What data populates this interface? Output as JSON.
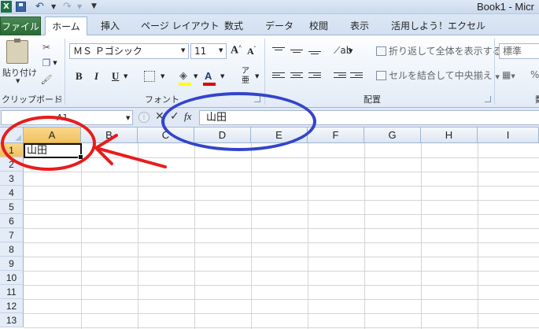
{
  "titlebar": {
    "app_icon_letter": "X",
    "window_title": "Book1 - Micr"
  },
  "ribbon_tabs": {
    "file": "ファイル",
    "items": [
      "ホーム",
      "挿入",
      "ページ レイアウト",
      "数式",
      "データ",
      "校閲",
      "表示",
      "活用しよう！エクセル"
    ],
    "active": "ホーム"
  },
  "clipboard": {
    "paste_label": "貼り付け",
    "group_label": "クリップボード"
  },
  "font": {
    "name": "ＭＳ Ｐゴシック",
    "size": "11",
    "grow": "A",
    "shrink": "A",
    "bold": "B",
    "italic": "I",
    "underline": "U",
    "font_color_glyph": "A",
    "phonetic_top": "ア",
    "phonetic_bottom": "亜",
    "group_label": "フォント"
  },
  "alignment": {
    "wrap_text": "折り返して全体を表示する",
    "merge_center": "セルを結合して中央揃え",
    "group_label": "配置"
  },
  "number": {
    "format": "標準",
    "currency_glyph": "",
    "percent_glyph": "%",
    "group_label_partial": "数"
  },
  "formula_bar": {
    "name_box": "A1",
    "cancel_glyph": "✕",
    "enter_glyph": "✓",
    "fx_label": "fx",
    "formula": "山田"
  },
  "grid": {
    "columns": [
      "A",
      "B",
      "C",
      "D",
      "E",
      "F",
      "G",
      "H",
      "I"
    ],
    "rows": [
      "1",
      "2",
      "3",
      "4",
      "5",
      "6",
      "7",
      "8",
      "9",
      "10",
      "11",
      "12",
      "13"
    ],
    "selected_column": "A",
    "selected_row": "1",
    "cells": {
      "A1": "山田"
    }
  },
  "colors": {
    "file_tab": "#2b6a35",
    "selected_header": "#f1c15f",
    "annotation_blue": "#3344cc",
    "annotation_red": "#e81c1c"
  }
}
